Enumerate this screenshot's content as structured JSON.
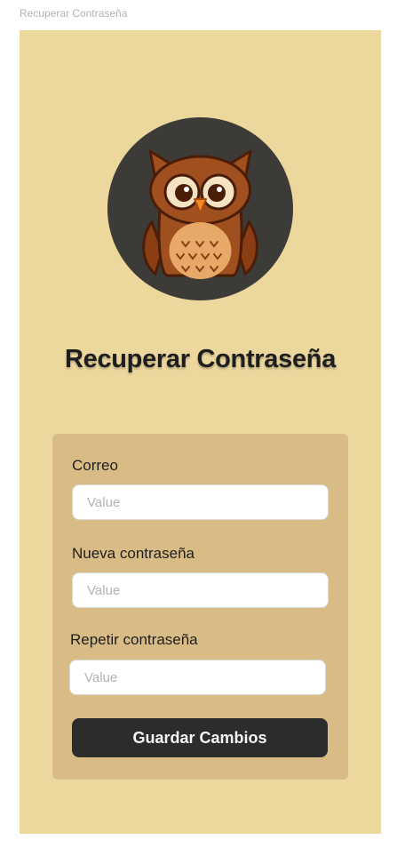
{
  "frame_label": "Recuperar Contraseña",
  "icons": {
    "avatar": "owl-icon"
  },
  "colors": {
    "background": "#ecd79d",
    "card": "#d9bc85",
    "button": "#2c2c2c",
    "avatar_bg": "#3d3b38"
  },
  "page": {
    "title": "Recuperar Contraseña"
  },
  "form": {
    "email_label": "Correo",
    "email_placeholder": "Value",
    "new_password_label": "Nueva contraseña",
    "new_password_placeholder": "Value",
    "repeat_password_label": "Repetir contraseña",
    "repeat_password_placeholder": "Value",
    "submit_label": "Guardar Cambios"
  }
}
